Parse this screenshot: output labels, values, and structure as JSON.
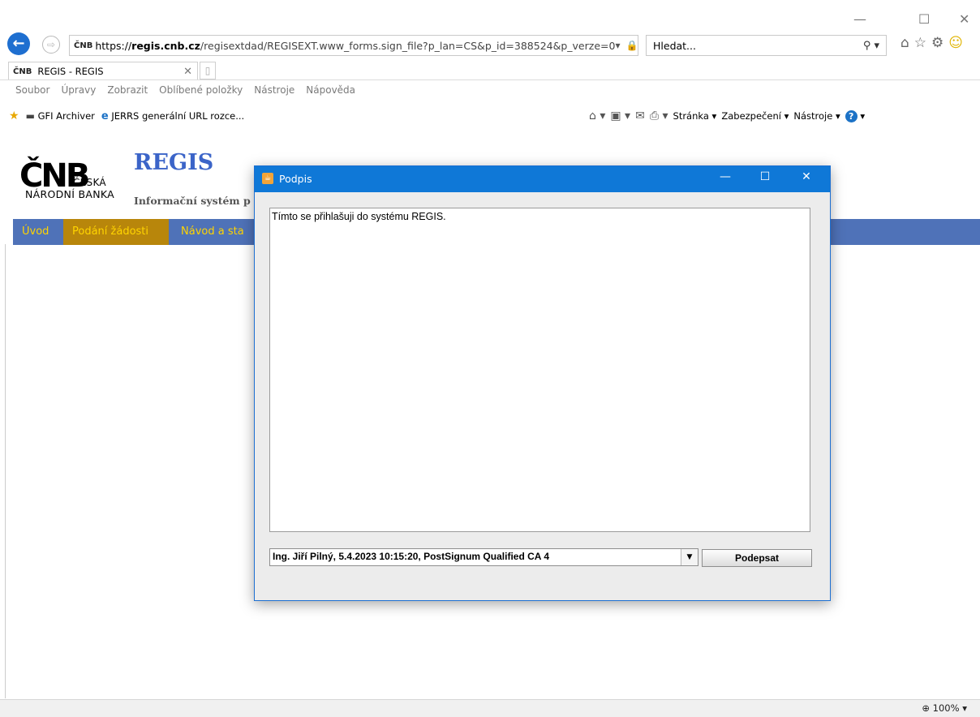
{
  "browser": {
    "window_controls": {
      "minimize": "—",
      "maximize": "☐",
      "close": "✕"
    },
    "address": {
      "favicon": "ČNB",
      "host_prefix": "https://",
      "host": "regis.cnb.cz",
      "path": "/regisextdad/REGISEXT.www_forms.sign_file?p_lan=CS&p_id=388524&p_verze=0"
    },
    "search": {
      "placeholder": "Hledat..."
    },
    "tab": {
      "label": "REGIS - REGIS",
      "favicon": "ČNB"
    },
    "menu": [
      "Soubor",
      "Úpravy",
      "Zobrazit",
      "Oblíbené položky",
      "Nástroje",
      "Nápověda"
    ],
    "favorites": [
      "GFI Archiver",
      "JERRS generální URL rozce..."
    ],
    "commands": {
      "page": "Stránka",
      "security": "Zabezpečení",
      "tools": "Nástroje"
    },
    "zoom": "100%"
  },
  "page": {
    "logo": {
      "big": "ČNB",
      "line1": "ČESKÁ",
      "line2": "NÁRODNÍ BANKA"
    },
    "title": "REGIS",
    "subtitle": "Informační systém p",
    "nav": [
      {
        "label": "Úvod",
        "active": false
      },
      {
        "label": "Podání žádosti",
        "active": true
      },
      {
        "label": "Návod a sta",
        "active": false
      }
    ]
  },
  "dialog": {
    "title": "Podpis",
    "text": "Tímto se přihlašuji do systému REGIS.",
    "certificate": "Ing. Jiří Pilný, 5.4.2023 10:15:20, PostSignum Qualified CA 4",
    "sign_button": "Podepsat"
  },
  "colors": {
    "accent": "#0f78d7",
    "nav_bg": "#4f72b8",
    "nav_active": "#b8860b",
    "nav_text": "#ffd400",
    "title": "#3b64c8"
  }
}
